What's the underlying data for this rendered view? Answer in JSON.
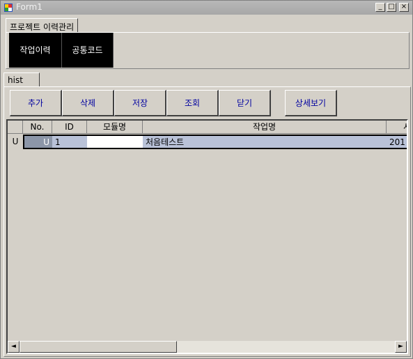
{
  "window": {
    "title": "Form1"
  },
  "title_buttons": {
    "minimize": "_",
    "maximize": "□",
    "close": "×"
  },
  "top_tab": {
    "label": "프로젝트 이력관리"
  },
  "nav_buttons": [
    {
      "label": "작업이력"
    },
    {
      "label": "공통코드"
    }
  ],
  "hist_tab": {
    "label": "hist"
  },
  "toolbar": [
    {
      "label": "추가"
    },
    {
      "label": "삭제"
    },
    {
      "label": "저장"
    },
    {
      "label": "조회"
    },
    {
      "label": "닫기"
    },
    {
      "label": "상세보기"
    }
  ],
  "grid": {
    "columns": [
      "No.",
      "ID",
      "모듈명",
      "작업명",
      "시"
    ],
    "rows": [
      {
        "indicator": "U",
        "no": "U",
        "id": "1",
        "module": "",
        "task": "처음테스트",
        "extra": "201"
      }
    ]
  },
  "scrollbar": {
    "left_arrow": "◄",
    "right_arrow": "►"
  }
}
